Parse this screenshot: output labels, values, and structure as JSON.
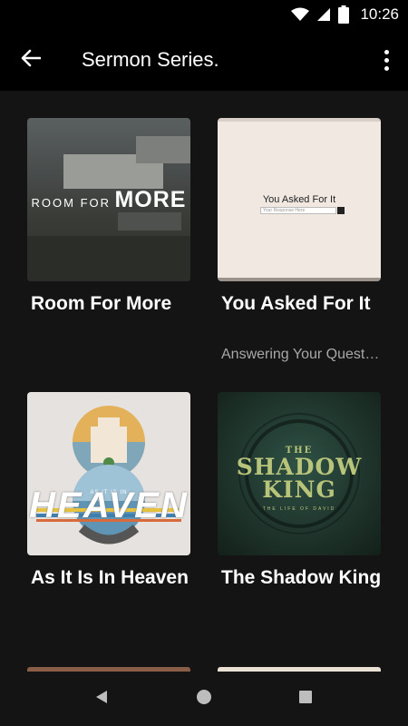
{
  "status_bar": {
    "time": "10:26",
    "icons": [
      "wifi-icon",
      "cell-signal-icon",
      "battery-icon"
    ]
  },
  "app_bar": {
    "title": "Sermon Series.",
    "back_icon": "arrow-left-icon",
    "menu_icon": "more-vert-icon"
  },
  "series": [
    {
      "title": "Room For More",
      "subtitle": "",
      "art": {
        "line1": "ROOM FOR",
        "line2": "MORE"
      }
    },
    {
      "title": "You Asked For It",
      "subtitle": "Answering Your Questions",
      "art": {
        "title": "You Asked For It",
        "placeholder": "Your Response Here"
      }
    },
    {
      "title": "As It Is In Heaven",
      "subtitle": "",
      "art": {
        "small": "AS IT IS IN",
        "big": "HEAVEN"
      }
    },
    {
      "title": "The Shadow King",
      "subtitle": "",
      "art": {
        "the": "THE",
        "big1": "SHADOW",
        "big2": "KING",
        "sub": "THE LIFE OF DAVID"
      }
    }
  ],
  "nav_bar": {
    "icons": [
      "back-triangle-icon",
      "home-circle-icon",
      "recents-square-icon"
    ]
  },
  "colors": {
    "background": "#141414",
    "bar": "#000000",
    "subtitle": "#a8a8a8",
    "shadow_king_accent": "#b9c47b"
  }
}
